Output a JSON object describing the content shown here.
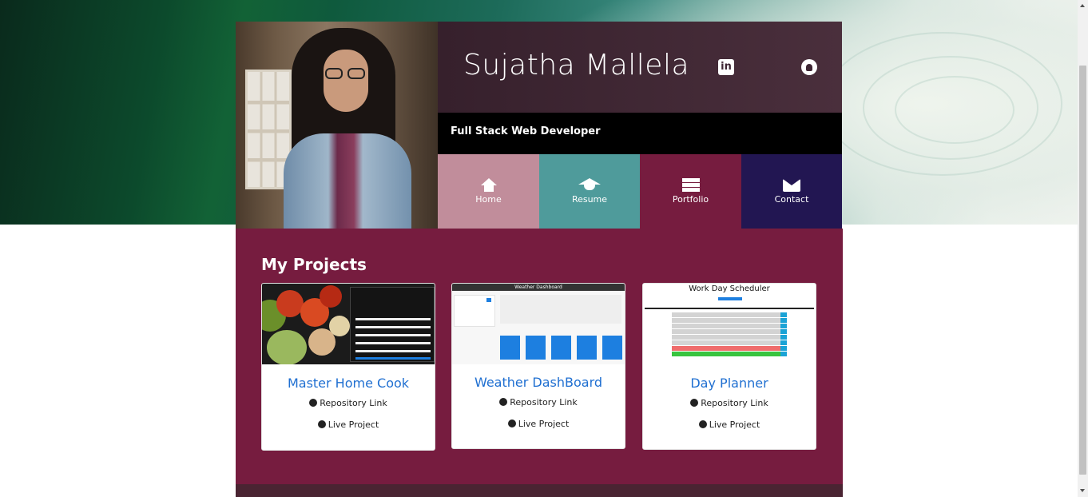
{
  "header": {
    "name": "Sujatha Mallela",
    "tagline": "Full Stack Web Developer",
    "social": [
      {
        "label": "in",
        "icon": "linkedin-icon"
      },
      {
        "label": "",
        "icon": "github-icon"
      }
    ]
  },
  "nav": [
    {
      "label": "Home",
      "icon": "home-icon",
      "color": "#c18d9b"
    },
    {
      "label": "Resume",
      "icon": "graduation-cap-icon",
      "color": "#4f9b9b"
    },
    {
      "label": "Portfolio",
      "icon": "server-icon",
      "color": "#761c3f"
    },
    {
      "label": "Contact",
      "icon": "envelope-icon",
      "color": "#221652"
    }
  ],
  "projects": {
    "title": "My Projects",
    "items": [
      {
        "title": "Master Home Cook",
        "repo_label": "Repository Link",
        "live_label": "Live Project"
      },
      {
        "title": "Weather DashBoard",
        "repo_label": "Repository Link",
        "live_label": "Live Project",
        "thumb_title": "Weather Dashboard"
      },
      {
        "title": "Day Planner",
        "repo_label": "Repository Link",
        "live_label": "Live Project",
        "thumb_title": "Work Day Scheduler"
      }
    ]
  },
  "colors": {
    "section_bg": "#761c3f",
    "link": "#1f6fd1",
    "header_panel": "#3e2533"
  }
}
